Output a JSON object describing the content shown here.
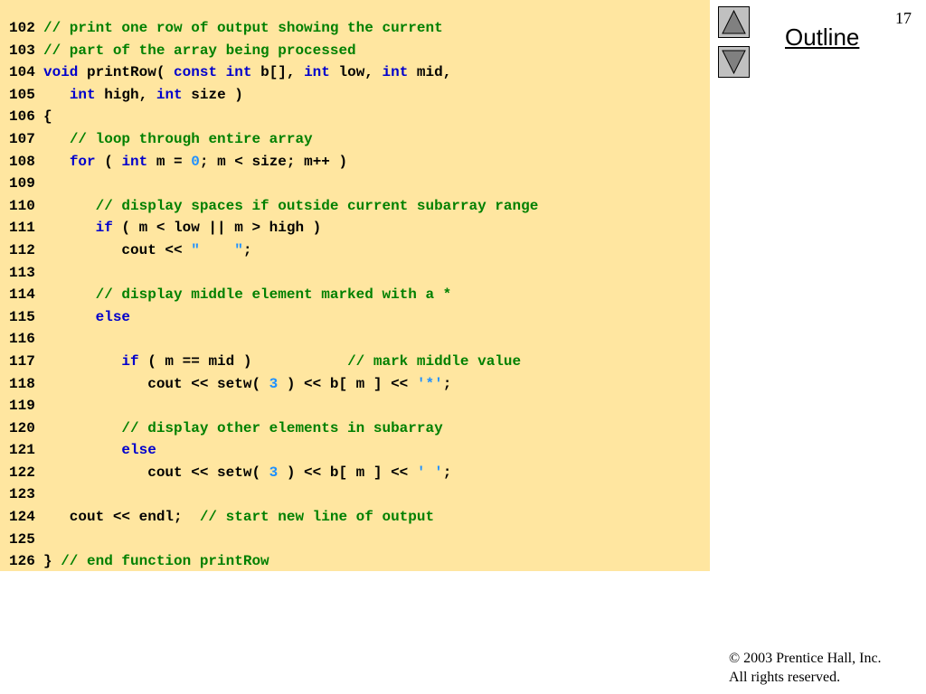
{
  "slide": {
    "number": "17",
    "outline_label": "Outline",
    "nav_up_icon": "triangle-up-icon",
    "nav_down_icon": "triangle-down-icon",
    "copyright_line1": "© 2003 Prentice Hall, Inc.",
    "copyright_line2": "All rights reserved."
  },
  "colors": {
    "code_background": "#ffe6a0",
    "comment": "#008000",
    "keyword": "#0000cc",
    "literal": "#1e90ff",
    "button": "#c0c0c0"
  },
  "code_lines": [
    {
      "num": "102",
      "tokens": [
        {
          "t": "c",
          "v": "// print one row of output showing the current"
        }
      ]
    },
    {
      "num": "103",
      "tokens": [
        {
          "t": "c",
          "v": "// part of the array being processed"
        }
      ]
    },
    {
      "num": "104",
      "tokens": [
        {
          "t": "k",
          "v": "void"
        },
        {
          "t": "t",
          "v": " printRow( "
        },
        {
          "t": "k",
          "v": "const"
        },
        {
          "t": "t",
          "v": " "
        },
        {
          "t": "k",
          "v": "int"
        },
        {
          "t": "t",
          "v": " b[], "
        },
        {
          "t": "k",
          "v": "int"
        },
        {
          "t": "t",
          "v": " low, "
        },
        {
          "t": "k",
          "v": "int"
        },
        {
          "t": "t",
          "v": " mid,"
        }
      ]
    },
    {
      "num": "105",
      "tokens": [
        {
          "t": "t",
          "v": "   "
        },
        {
          "t": "k",
          "v": "int"
        },
        {
          "t": "t",
          "v": " high, "
        },
        {
          "t": "k",
          "v": "int"
        },
        {
          "t": "t",
          "v": " size )"
        }
      ]
    },
    {
      "num": "106",
      "tokens": [
        {
          "t": "t",
          "v": "{"
        }
      ]
    },
    {
      "num": "107",
      "tokens": [
        {
          "t": "t",
          "v": "   "
        },
        {
          "t": "c",
          "v": "// loop through entire array"
        }
      ]
    },
    {
      "num": "108",
      "tokens": [
        {
          "t": "t",
          "v": "   "
        },
        {
          "t": "k",
          "v": "for"
        },
        {
          "t": "t",
          "v": " ( "
        },
        {
          "t": "k",
          "v": "int"
        },
        {
          "t": "t",
          "v": " m = "
        },
        {
          "t": "n",
          "v": "0"
        },
        {
          "t": "t",
          "v": "; m < size; m++ )"
        }
      ]
    },
    {
      "num": "109",
      "tokens": []
    },
    {
      "num": "110",
      "tokens": [
        {
          "t": "t",
          "v": "      "
        },
        {
          "t": "c",
          "v": "// display spaces if outside current subarray range"
        }
      ]
    },
    {
      "num": "111",
      "tokens": [
        {
          "t": "t",
          "v": "      "
        },
        {
          "t": "k",
          "v": "if"
        },
        {
          "t": "t",
          "v": " ( m < low || m > high )"
        }
      ]
    },
    {
      "num": "112",
      "tokens": [
        {
          "t": "t",
          "v": "         cout << "
        },
        {
          "t": "s",
          "v": "\"    \""
        },
        {
          "t": "t",
          "v": ";"
        }
      ]
    },
    {
      "num": "113",
      "tokens": []
    },
    {
      "num": "114",
      "tokens": [
        {
          "t": "t",
          "v": "      "
        },
        {
          "t": "c",
          "v": "// display middle element marked with a *"
        }
      ]
    },
    {
      "num": "115",
      "tokens": [
        {
          "t": "t",
          "v": "      "
        },
        {
          "t": "k",
          "v": "else"
        }
      ]
    },
    {
      "num": "116",
      "tokens": []
    },
    {
      "num": "117",
      "tokens": [
        {
          "t": "t",
          "v": "         "
        },
        {
          "t": "k",
          "v": "if"
        },
        {
          "t": "t",
          "v": " ( m == mid )           "
        },
        {
          "t": "c",
          "v": "// mark middle value"
        }
      ]
    },
    {
      "num": "118",
      "tokens": [
        {
          "t": "t",
          "v": "            cout << setw( "
        },
        {
          "t": "n",
          "v": "3"
        },
        {
          "t": "t",
          "v": " ) << b[ m ] << "
        },
        {
          "t": "s",
          "v": "'*'"
        },
        {
          "t": "t",
          "v": ";"
        }
      ]
    },
    {
      "num": "119",
      "tokens": []
    },
    {
      "num": "120",
      "tokens": [
        {
          "t": "t",
          "v": "         "
        },
        {
          "t": "c",
          "v": "// display other elements in subarray"
        }
      ]
    },
    {
      "num": "121",
      "tokens": [
        {
          "t": "t",
          "v": "         "
        },
        {
          "t": "k",
          "v": "else"
        }
      ]
    },
    {
      "num": "122",
      "tokens": [
        {
          "t": "t",
          "v": "            cout << setw( "
        },
        {
          "t": "n",
          "v": "3"
        },
        {
          "t": "t",
          "v": " ) << b[ m ] << "
        },
        {
          "t": "s",
          "v": "' '"
        },
        {
          "t": "t",
          "v": ";"
        }
      ]
    },
    {
      "num": "123",
      "tokens": []
    },
    {
      "num": "124",
      "tokens": [
        {
          "t": "t",
          "v": "   cout << endl;  "
        },
        {
          "t": "c",
          "v": "// start new line of output"
        }
      ]
    },
    {
      "num": "125",
      "tokens": []
    },
    {
      "num": "126",
      "tokens": [
        {
          "t": "t",
          "v": "} "
        },
        {
          "t": "c",
          "v": "// end function printRow"
        }
      ]
    }
  ]
}
